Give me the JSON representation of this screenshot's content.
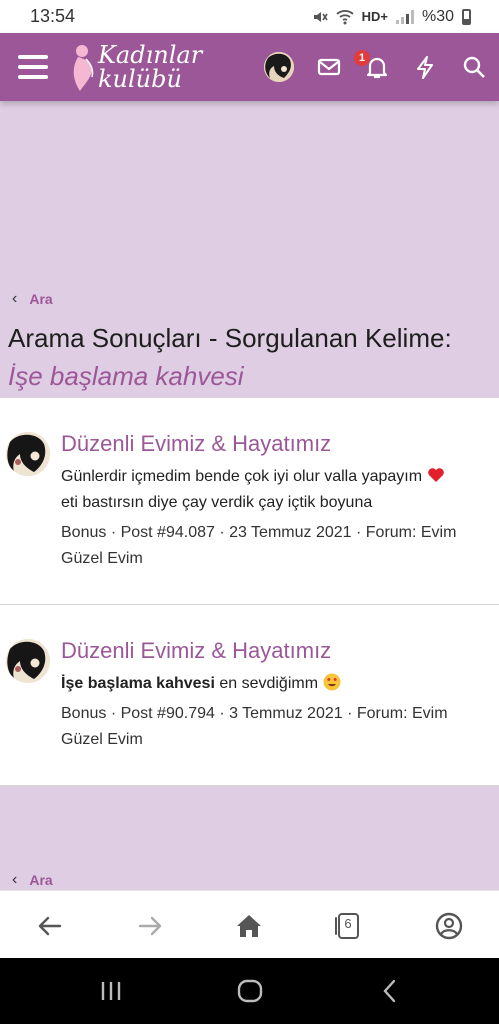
{
  "status_bar": {
    "time": "13:54",
    "network": "HD+",
    "battery": "%30"
  },
  "header": {
    "logo_text": "Kadınlar\nkulübü",
    "notification_count": "1"
  },
  "breadcrumb": {
    "label": "Ara"
  },
  "page": {
    "title": "Arama Sonuçları - Sorgulanan Kelime:",
    "query": "İşe başlama kahvesi"
  },
  "results": [
    {
      "title": "Düzenli Evimiz & Hayatımız",
      "snippet": "Günlerdir içmedim bende çok iyi olur valla yapayım",
      "snippet_cont": "eti bastırsın diye çay verdik çay içtik boyuna",
      "meta": "Bonus · Post #94.087 · 23 Temmuz 2021 · Forum: Evim Güzel Evim"
    },
    {
      "title": "Düzenli Evimiz & Hayatımız",
      "snippet_bold": "İşe başlama kahvesi",
      "snippet": " en sevdiğimm",
      "meta": "Bonus · Post #90.794 · 3 Temmuz 2021 · Forum: Evim Güzel Evim"
    }
  ],
  "browser_bar": {
    "tab_count": "6"
  },
  "colors": {
    "brand": "#9b5797",
    "page_bg": "#dfcde3",
    "badge": "#e23b3b"
  },
  "icons": [
    "hamburger-icon",
    "mail-icon",
    "bell-icon",
    "bolt-icon",
    "search-icon",
    "back-arrow-icon",
    "forward-arrow-icon",
    "home-icon",
    "tabs-icon",
    "account-icon",
    "recents-icon",
    "home-circle-icon",
    "nav-back-icon",
    "heart-emoji",
    "heart-eyes-emoji"
  ]
}
